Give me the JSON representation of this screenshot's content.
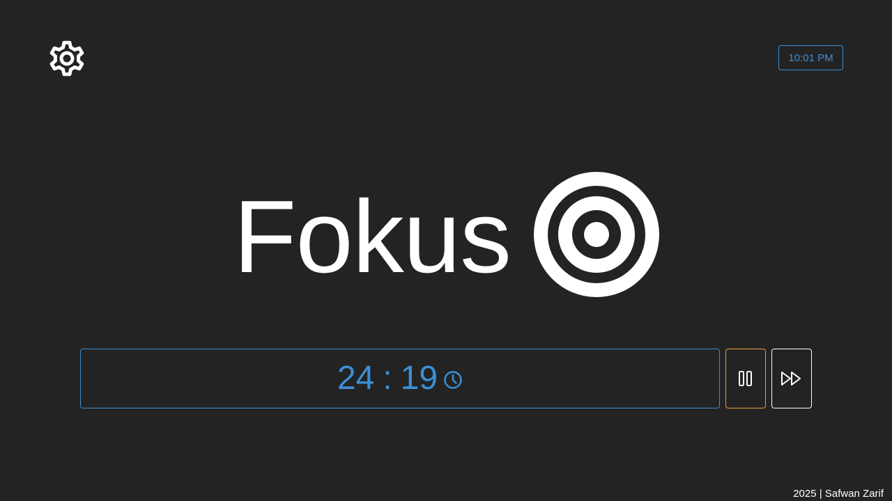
{
  "app": {
    "title": "Fokus",
    "logo_icon": "target-icon"
  },
  "header": {
    "settings_icon": "gear-icon",
    "clock_time": "10:01 PM"
  },
  "timer": {
    "minutes": "24",
    "separator": ":",
    "seconds": "19",
    "icon": "clock-icon"
  },
  "controls": {
    "pause_icon": "pause-icon",
    "skip_icon": "fast-forward-icon"
  },
  "footer": {
    "credit": "2025 | Safwan Zarif"
  },
  "colors": {
    "background": "#232323",
    "accent_blue": "#3b8fd6",
    "pause_border": "#e8a23a",
    "text": "#ffffff"
  }
}
